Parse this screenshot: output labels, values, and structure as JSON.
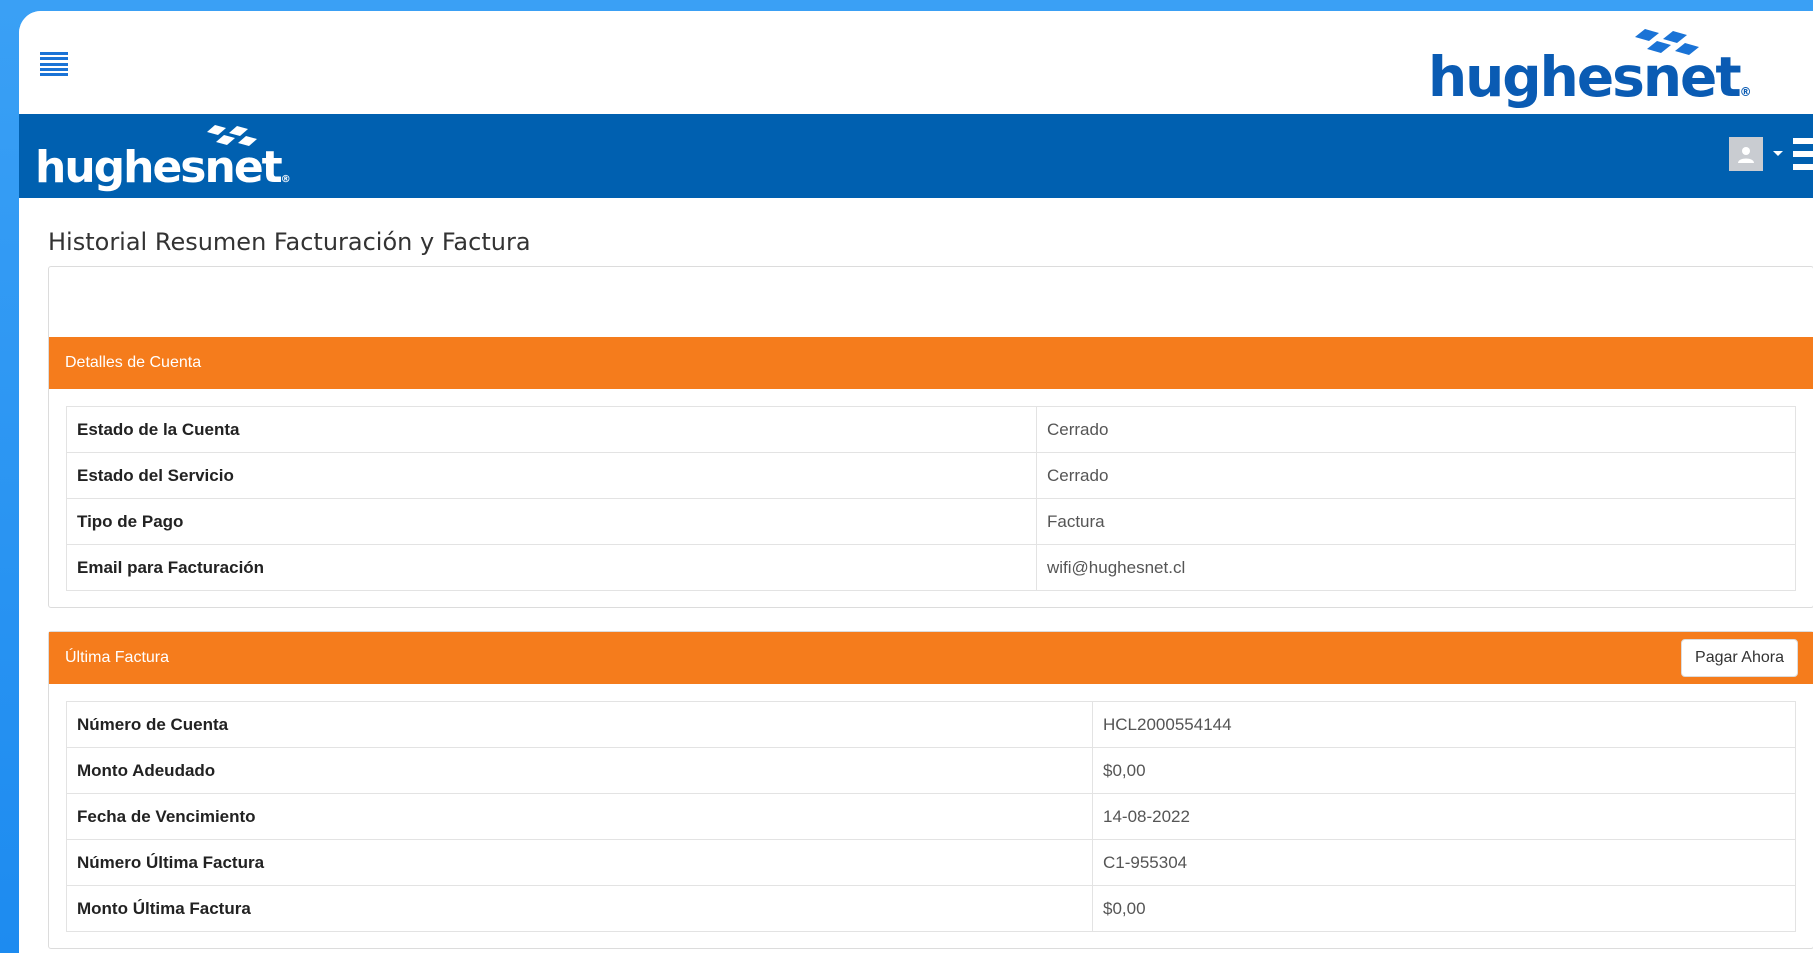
{
  "brand": {
    "name": "hughesnet",
    "registered_mark": "®",
    "primary_color": "#0060b0",
    "accent_color": "#f57c1c",
    "background_color": "#1d8bf0"
  },
  "topbar": {
    "menu_icon": "hamburger-icon"
  },
  "navbar": {
    "user_icon": "user-icon",
    "dropdown_icon": "caret-down-icon",
    "menu_icon": "hamburger-icon"
  },
  "page": {
    "title": "Historial Resumen Facturación y Factura"
  },
  "account_details": {
    "heading": "Detalles de Cuenta",
    "rows": [
      {
        "label": "Estado de la Cuenta",
        "value": "Cerrado"
      },
      {
        "label": "Estado del Servicio",
        "value": "Cerrado"
      },
      {
        "label": "Tipo de Pago",
        "value": "Factura"
      },
      {
        "label": "Email para Facturación",
        "value": "wifi@hughesnet.cl"
      }
    ]
  },
  "last_invoice": {
    "heading": "Última Factura",
    "pay_button": "Pagar Ahora",
    "rows": [
      {
        "label": "Número de Cuenta",
        "value": "HCL2000554144"
      },
      {
        "label": "Monto Adeudado",
        "value": "$0,00"
      },
      {
        "label": "Fecha de Vencimiento",
        "value": "14-08-2022"
      },
      {
        "label": "Número Última Factura",
        "value": "C1-955304"
      },
      {
        "label": "Monto Última Factura",
        "value": "$0,00"
      }
    ]
  }
}
